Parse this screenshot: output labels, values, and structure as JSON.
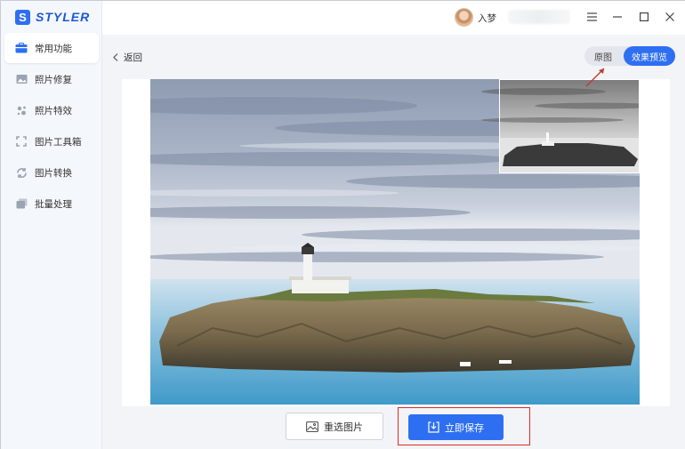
{
  "app": {
    "logo_letter": "S",
    "logo_text": "STYLER"
  },
  "sidebar": {
    "items": [
      {
        "label": "常用功能",
        "icon": "toolbox-icon",
        "active": true
      },
      {
        "label": "照片修复",
        "icon": "photo-repair-icon",
        "active": false
      },
      {
        "label": "照片特效",
        "icon": "sparkle-icon",
        "active": false
      },
      {
        "label": "图片工具箱",
        "icon": "crop-frame-icon",
        "active": false
      },
      {
        "label": "图片转换",
        "icon": "convert-icon",
        "active": false
      },
      {
        "label": "批量处理",
        "icon": "batch-icon",
        "active": false
      }
    ]
  },
  "titlebar": {
    "username": "入梦",
    "controls": [
      "menu-icon",
      "minimize-icon",
      "maximize-icon",
      "close-icon"
    ]
  },
  "content": {
    "back_label": "返回",
    "toggle": {
      "original_label": "原图",
      "preview_label": "效果预览",
      "selected": "preview"
    },
    "reselect_label": "重选图片",
    "save_label": "立即保存"
  },
  "colors": {
    "accent": "#2e6ff2",
    "highlight_box": "#e02a2a",
    "arrow": "#c0392b"
  }
}
